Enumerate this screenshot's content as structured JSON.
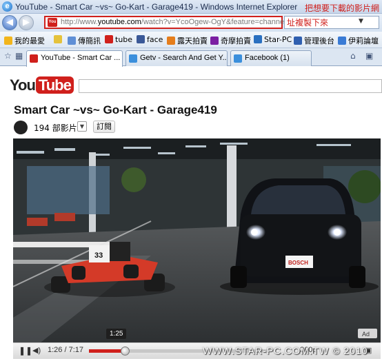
{
  "window": {
    "title": "YouTube - Smart Car ~vs~ Go-Kart - Garage419 - Windows Internet Explorer",
    "annotation_top": "把想要下載的影片網"
  },
  "address": {
    "url_prefix": "http://www.",
    "url_domain": "youtube.com",
    "url_rest": "/watch?v=YcoOgew-OgY&feature=channel",
    "annotation": "址複製下來"
  },
  "favorites": {
    "label": "我的最愛",
    "items": [
      "傳簡訊",
      "tube",
      "face",
      "露天拍賣",
      "奇摩拍賣",
      "Star-PC",
      "管理後台",
      "伊莉論壇"
    ]
  },
  "tabs": [
    {
      "label": "YouTube - Smart Car ..."
    },
    {
      "label": "Getv - Search And Get Y..."
    },
    {
      "label": "Facebook (1)"
    }
  ],
  "youtube": {
    "logo_you": "You",
    "logo_tube": "Tube",
    "video_title": "Smart Car ~vs~ Go-Kart - Garage419",
    "video_count": "194 部影片",
    "subscribe": "訂閱"
  },
  "player": {
    "time": "1:26 / 7:17",
    "tooltip": "1:25",
    "progress_fraction": 0.2,
    "quality": "360p",
    "ad_badge": "Ad",
    "watermark": "WWW.STAR-PC.COM.TW © 2010"
  },
  "colors": {
    "accent": "#d0201c",
    "chrome": "#dce6f2"
  }
}
